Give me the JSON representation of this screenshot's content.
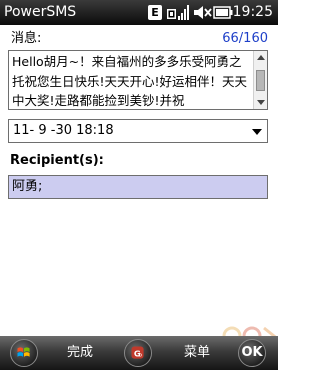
{
  "app": {
    "title": "PowerSMS"
  },
  "status": {
    "network_type": "E",
    "time": "19:25",
    "icons": [
      "edge-icon",
      "signal-icon",
      "sound-muted-icon",
      "battery-icon"
    ]
  },
  "message": {
    "label": "消息:",
    "char_count": "66/160",
    "text": "Hello胡月~！来自福州的多多乐受阿勇之托祝您生日快乐!天天开心!好运相伴！天天中大奖!走路都能捡到美钞!并祝"
  },
  "schedule": {
    "date_value": "11- 9 -30 18:18"
  },
  "recipients": {
    "label": "Recipient(s):",
    "value": "阿勇;"
  },
  "softkeys": {
    "left_label": "完成",
    "right_label": "菜单",
    "ok_label": "OK"
  },
  "colors": {
    "accent": "#1e3fc8",
    "recipient_bg": "#ccccf0",
    "titlebar": "#111111"
  }
}
